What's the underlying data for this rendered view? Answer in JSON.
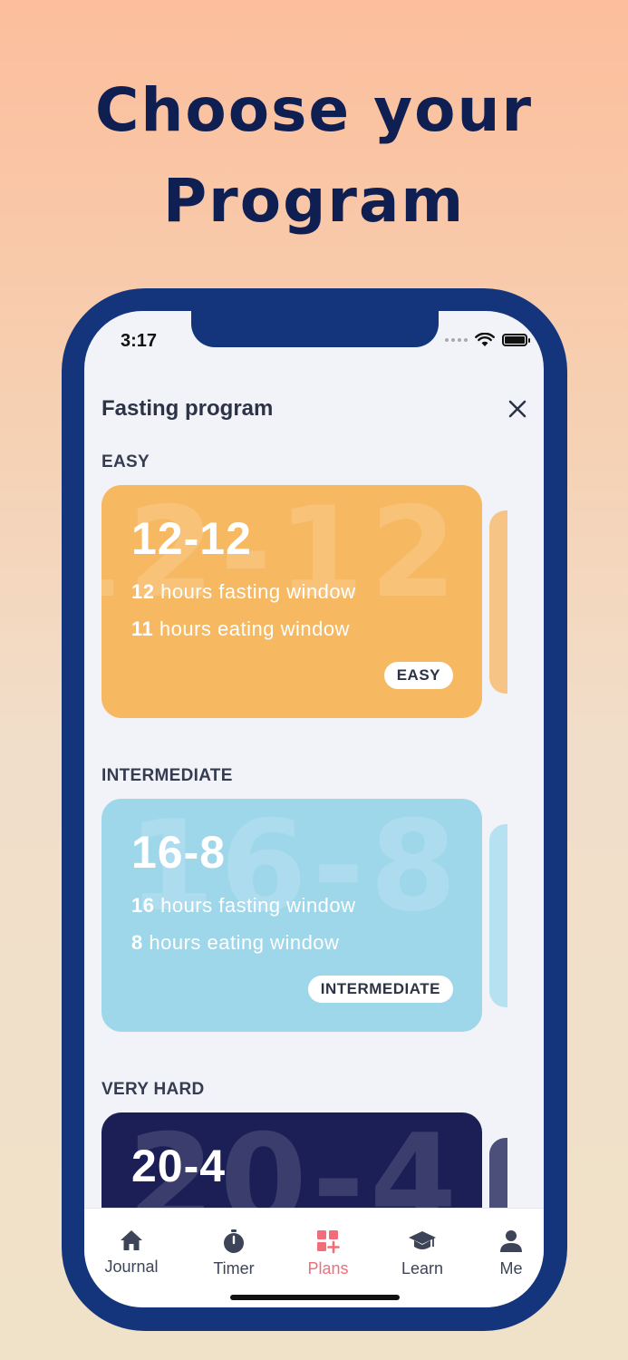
{
  "headline": {
    "line1": "Choose your",
    "line2": "Program"
  },
  "status_bar": {
    "time": "3:17"
  },
  "sheet": {
    "title": "Fasting program"
  },
  "sections": [
    {
      "label": "EASY",
      "card": {
        "plan": "12-12",
        "bg_text": "12-12",
        "fasting_hours": "12",
        "fasting_text": " hours fasting window",
        "eating_hours": "11",
        "eating_text": " hours eating window",
        "badge": "EASY",
        "color": "#f7b862",
        "peek_color": "#f6c585"
      }
    },
    {
      "label": "INTERMEDIATE",
      "card": {
        "plan": "16-8",
        "bg_text": "16-8",
        "fasting_hours": "16",
        "fasting_text": " hours fasting window",
        "eating_hours": "8",
        "eating_text": " hours eating window",
        "badge": "INTERMEDIATE",
        "color": "#9fd7ea",
        "peek_color": "#b5e1f0"
      }
    },
    {
      "label": "VERY HARD",
      "card": {
        "plan": "20-4",
        "bg_text": "20-4",
        "color": "#1b1f56",
        "peek_color": "#4b4f7a"
      }
    }
  ],
  "tabbar": {
    "items": [
      {
        "label": "Journal",
        "icon": "home-icon"
      },
      {
        "label": "Timer",
        "icon": "stopwatch-icon"
      },
      {
        "label": "Plans",
        "icon": "plans-grid-icon",
        "active": true
      },
      {
        "label": "Learn",
        "icon": "graduation-cap-icon"
      },
      {
        "label": "Me",
        "icon": "person-icon"
      }
    ],
    "active_color": "#f26c79",
    "inactive_color": "#3d4457"
  }
}
